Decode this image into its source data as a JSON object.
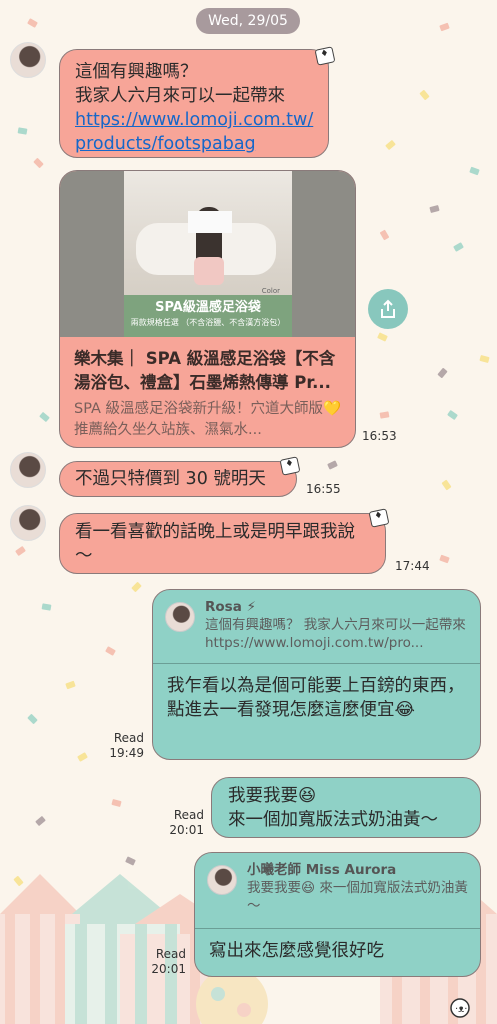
{
  "chat": {
    "date": "Wed, 29/05",
    "messages": {
      "m1": {
        "line1": "這個有興趣嗎？",
        "line2": "我家人六月來可以一起帶來",
        "link1": "https://www.lomoji.com.tw/",
        "link2": "products/footspabag"
      },
      "card": {
        "image_title": "SPA級溫感足浴袋",
        "image_subtitle": "兩款規格任選",
        "image_note": "（不含浴鹽、不含漢方浴包）",
        "color_label": "Color",
        "title": "樂木集｜ SPA 級溫感足浴袋【不含湯浴包、禮盒】石墨烯熱傳導 Pr...",
        "desc": "SPA 級溫感足浴袋新升級！穴道大師版💛推薦給久坐久站族、濕氣水...",
        "time": "16:53"
      },
      "m2": {
        "text": "不過只特價到 30 號明天",
        "time": "16:55"
      },
      "m3": {
        "text": "看一看喜歡的話晚上或是明早跟我說～",
        "time": "17:44"
      },
      "m4": {
        "quote_name": "Rosa ⚡",
        "quote_text": "這個有興趣嗎？ 我家人六月來可以一起帶來 https://www.lomoji.com.tw/pro...",
        "text": "我乍看以為是個可能要上百鎊的東西，點進去一看發現怎麼這麼便宜😂",
        "read": "Read",
        "time": "19:49"
      },
      "m5": {
        "line1": "我要我要😆",
        "line2": "來一個加寬版法式奶油黃～",
        "read": "Read",
        "time": "20:01"
      },
      "m6": {
        "quote_name": "小曦老師 Miss Aurora",
        "quote_text": "我要我要😆 來一個加寬版法式奶油黃～",
        "text": "寫出來怎麼感覺很好吃",
        "read": "Read",
        "time": "20:01"
      }
    }
  },
  "colors": {
    "incoming": "#f7a598",
    "outgoing": "#8fd1c6",
    "date_pill": "#a89a9d",
    "background": "#fbf5ec",
    "link": "#1667c9"
  },
  "icons": {
    "share": "share-icon",
    "sticker": "playing-cards-icon",
    "avatar": "user-avatar"
  }
}
